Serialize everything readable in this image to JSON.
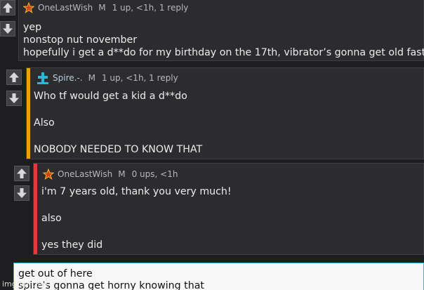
{
  "colors": {
    "background": "#1e1e20",
    "comment_bg": "#2c2c2f",
    "accent_orange": "#f39c12",
    "accent_red": "#e33a3a",
    "reply_border": "#2fb7d8",
    "user_icon_cyan": "#2bb5d9"
  },
  "comments": [
    {
      "username": "OneLastWish",
      "gender": "M",
      "meta": "1 up, <1h, 1 reply",
      "user_icon": "star-icon",
      "lines": [
        "yep",
        "nonstop nut november",
        "hopefully i get a d**do for my birthday on the 17th, vibrator’s gonna get old fast"
      ]
    },
    {
      "username": "Spire.-.",
      "gender": "M",
      "meta": "1 up, <1h, 1 reply",
      "user_icon": "cross-icon",
      "lines": [
        "Who tf would get a kid a d**do",
        "Also",
        "NOBODY NEEDED TO KNOW THAT"
      ]
    },
    {
      "username": "OneLastWish",
      "gender": "M",
      "meta": "0 ups, <1h",
      "user_icon": "star-icon",
      "lines": [
        "i'm 7 years old, thank you very much!",
        "also",
        "yes they did"
      ]
    }
  ],
  "reply": {
    "text": "get out of here\nspire's gonna get horny knowing that"
  },
  "watermark": "imgflip.com"
}
